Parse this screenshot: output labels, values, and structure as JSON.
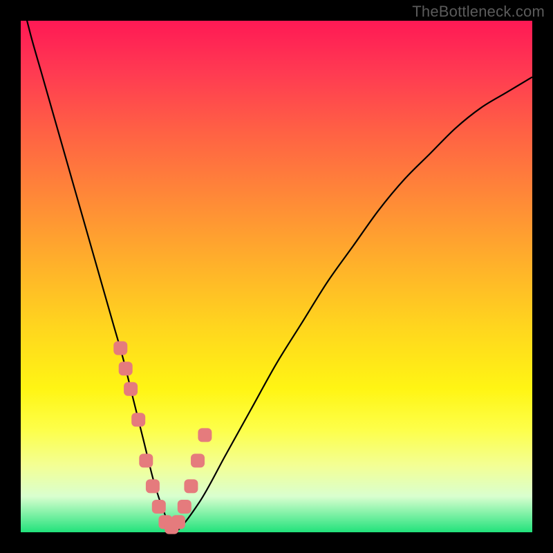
{
  "watermark": "TheBottleneck.com",
  "colors": {
    "frame": "#000000",
    "curve": "#000000",
    "marker_fill": "#e57b7d",
    "marker_stroke": "#c9595e",
    "gradient_top": "#ff1955",
    "gradient_bottom": "#21e27b"
  },
  "chart_data": {
    "type": "line",
    "title": "",
    "xlabel": "",
    "ylabel": "",
    "xlim": [
      0,
      100
    ],
    "ylim": [
      0,
      100
    ],
    "series": [
      {
        "name": "curve",
        "x": [
          0,
          2,
          4,
          6,
          8,
          10,
          12,
          14,
          16,
          18,
          20,
          22,
          24,
          26,
          28,
          30,
          35,
          40,
          45,
          50,
          55,
          60,
          65,
          70,
          75,
          80,
          85,
          90,
          95,
          100
        ],
        "y": [
          105,
          97,
          90,
          83,
          76,
          69,
          62,
          55,
          48,
          41,
          34,
          26,
          18,
          10,
          4,
          0,
          6,
          15,
          24,
          33,
          41,
          49,
          56,
          63,
          69,
          74,
          79,
          83,
          86,
          89
        ]
      }
    ],
    "markers": {
      "name": "highlighted-points",
      "x": [
        19.5,
        20.5,
        21.5,
        23.0,
        24.5,
        25.8,
        27.0,
        28.3,
        29.5,
        30.8,
        32.0,
        33.3,
        34.6,
        36.0
      ],
      "y": [
        36,
        32,
        28,
        22,
        14,
        9,
        5,
        2,
        1,
        2,
        5,
        9,
        14,
        19
      ]
    }
  }
}
